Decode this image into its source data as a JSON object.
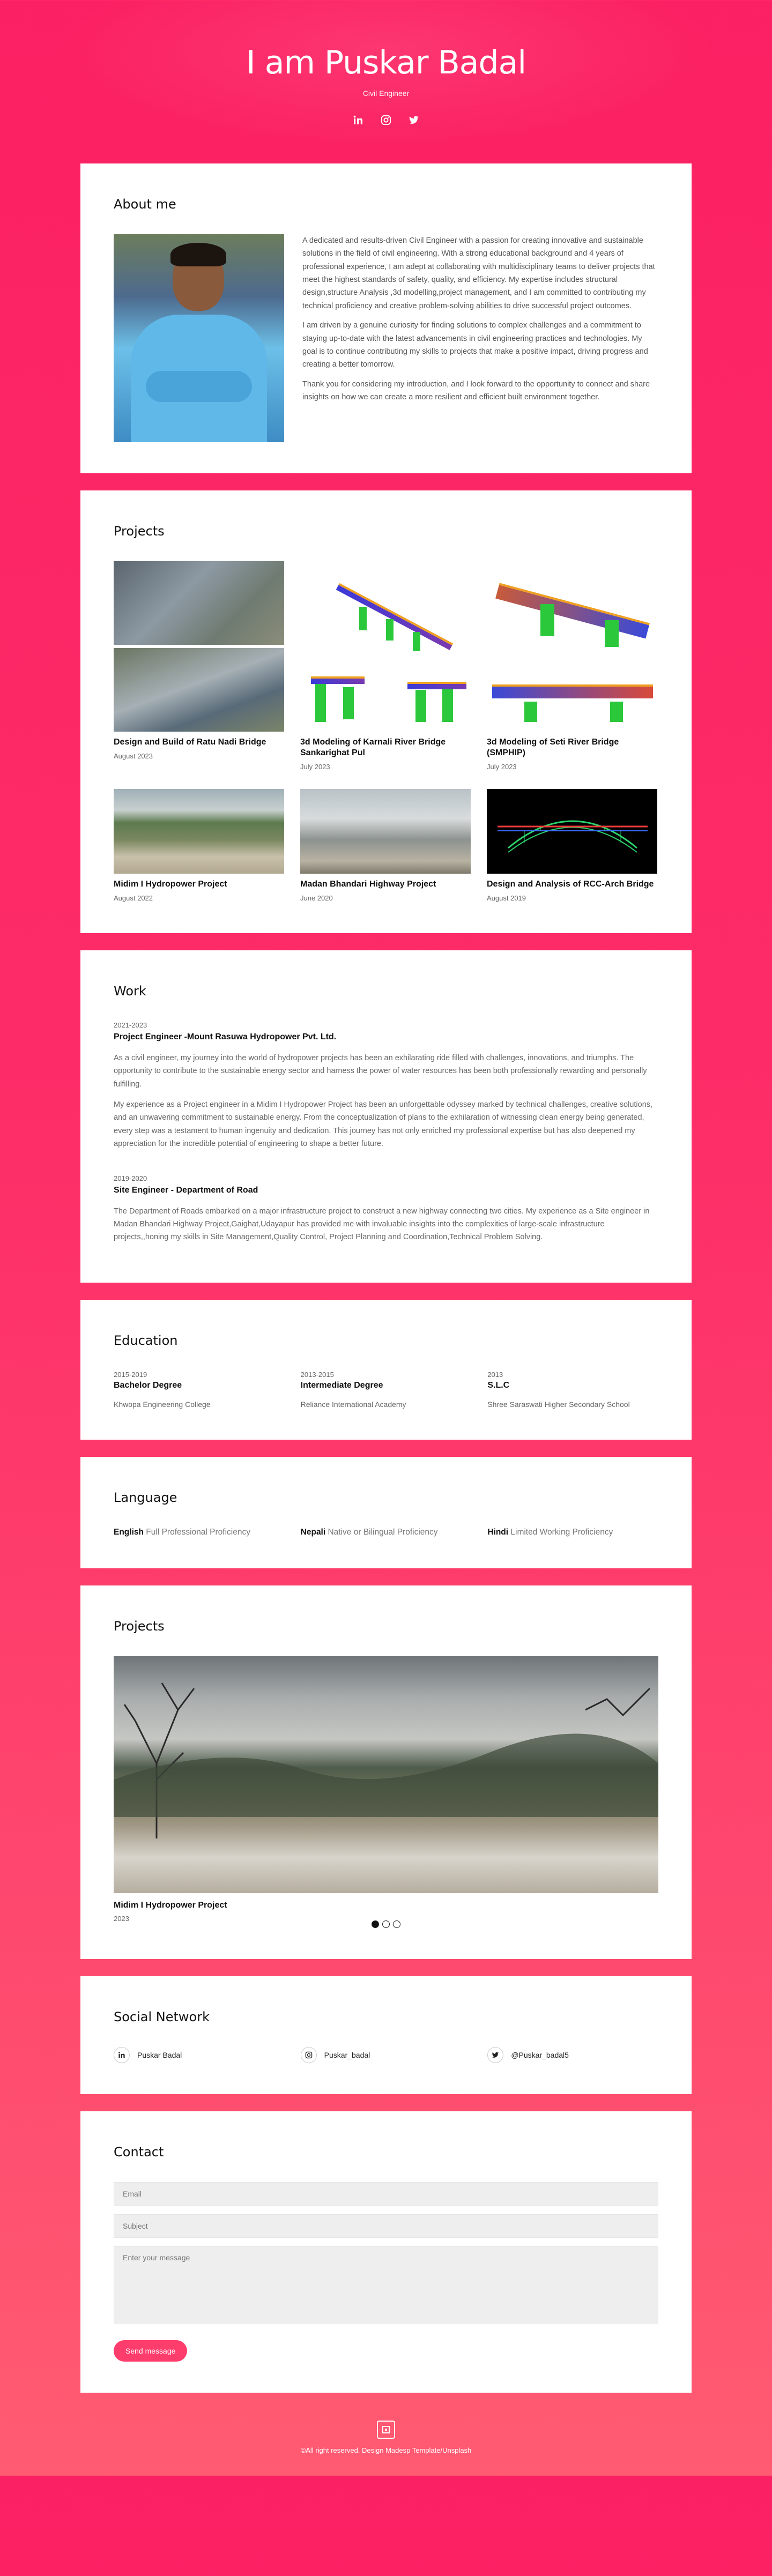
{
  "hero": {
    "title": "I am Puskar Badal",
    "subtitle": "Civil Engineer"
  },
  "about": {
    "heading": "About me",
    "paragraphs": [
      "A dedicated and results-driven Civil Engineer with a passion for creating innovative and sustainable solutions in the field of civil engineering. With a strong educational background and 4 years of professional experience, I am adept at collaborating with multidisciplinary teams to deliver projects that meet the highest standards of safety, quality, and efficiency. My expertise includes structural design,structure Analysis ,3d modelling,project management, and I am committed to contributing my technical proficiency and creative problem-solving abilities to drive successful project outcomes.",
      "I am driven by a genuine curiosity for finding solutions to complex challenges and a commitment to staying up-to-date with the latest advancements in civil engineering practices and technologies. My goal is to continue contributing my skills to projects that make a positive impact, driving progress and creating a better tomorrow.",
      "Thank you for considering my introduction, and I look forward to the opportunity to connect and share insights on how we can create a more resilient and efficient built environment together."
    ]
  },
  "projects": {
    "heading": "Projects",
    "items": [
      {
        "title": "Design and Build of Ratu Nadi Bridge",
        "date": "August 2023"
      },
      {
        "title": "3d Modeling of Karnali River Bridge Sankarighat Pul",
        "date": "July 2023"
      },
      {
        "title": "3d Modeling of Seti River Bridge (SMPHIP)",
        "date": "July 2023"
      },
      {
        "title": "Midim I Hydropower Project",
        "date": "August 2022"
      },
      {
        "title": "Madan Bhandari Highway Project",
        "date": "June 2020"
      },
      {
        "title": "Design and Analysis of RCC-Arch Bridge",
        "date": "August 2019"
      }
    ]
  },
  "work": {
    "heading": "Work",
    "items": [
      {
        "years": "2021-2023",
        "title": "Project Engineer -Mount Rasuwa Hydropower Pvt. Ltd.",
        "paragraphs": [
          "As a civil engineer, my journey into the world of hydropower projects has been an exhilarating ride filled with challenges, innovations, and triumphs. The opportunity to contribute to the sustainable energy sector and harness the power of water resources has been both professionally rewarding and personally fulfilling.",
          "My experience as a Project engineer in a Midim I Hydropower Project has been an unforgettable odyssey marked by technical challenges, creative solutions, and an unwavering commitment to sustainable energy. From the conceptualization of plans to the exhilaration of witnessing clean energy being generated, every step was a testament to human ingenuity and dedication. This journey has not only enriched my professional expertise but has also deepened my appreciation for the incredible potential of engineering to shape a better future."
        ]
      },
      {
        "years": "2019-2020",
        "title": "Site Engineer - Department of Road",
        "paragraphs": [
          "The Department of Roads embarked on a major infrastructure project to construct a new highway connecting two cities. My experience as a Site engineer in Madan Bhandari Highway Project,Gaighat,Udayapur has provided me with invaluable insights into the complexities of large-scale infrastructure projects,,honing my skills in Site Management,Quality Control, Project Planning and Coordination,Technical Problem Solving."
        ]
      }
    ]
  },
  "education": {
    "heading": "Education",
    "items": [
      {
        "years": "2015-2019",
        "degree": "Bachelor Degree",
        "school": "Khwopa Engineering College"
      },
      {
        "years": "2013-2015",
        "degree": "Intermediate Degree",
        "school": "Reliance International Academy"
      },
      {
        "years": "2013",
        "degree": "S.L.C",
        "school": "Shree Saraswati Higher Secondary School"
      }
    ]
  },
  "language": {
    "heading": "Language",
    "items": [
      {
        "name": "English",
        "level": "Full Professional Proficiency"
      },
      {
        "name": "Nepali",
        "level": "Native or Bilingual Proficiency"
      },
      {
        "name": "Hindi",
        "level": "Limited Working Proficiency"
      }
    ]
  },
  "featured": {
    "heading": "Projects",
    "title": "Midim I Hydropower Project",
    "date": "2023",
    "slide_count": 3,
    "active_slide": 1
  },
  "social": {
    "heading": "Social Network",
    "items": [
      {
        "icon": "linkedin-icon",
        "label": "Puskar Badal"
      },
      {
        "icon": "instagram-icon",
        "label": "Puskar_badal"
      },
      {
        "icon": "twitter-icon",
        "label": "@Puskar_badal5"
      }
    ]
  },
  "contact": {
    "heading": "Contact",
    "email_placeholder": "Email",
    "subject_placeholder": "Subject",
    "message_placeholder": "Enter your message",
    "send_label": "Send message"
  },
  "footer": {
    "text": "©All right reserved. Design Madesp Template/Unsplash"
  },
  "colors": {
    "accent": "#ff3d6d",
    "background_top": "#fb2063",
    "background_bottom": "#ff5b72"
  }
}
